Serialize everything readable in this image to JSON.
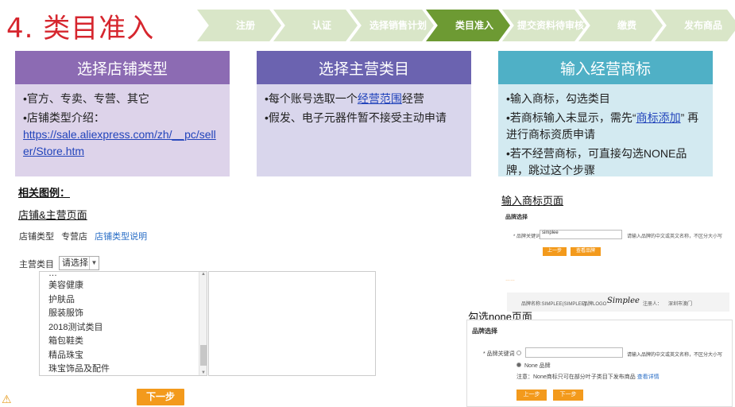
{
  "title": "4. 类目准入",
  "steps": [
    "注册",
    "认证",
    "选择销售计划",
    "类目准入",
    "提交资料待审核",
    "缴费",
    "发布商品"
  ],
  "active_step": "类目准入",
  "cards": [
    {
      "head": "选择店铺类型",
      "bullets": [
        "•官方、专卖、专营、其它",
        "•店铺类型介绍："
      ],
      "link": "https://sale.aliexpress.com/zh/__pc/seller/Store.htm"
    },
    {
      "head": "选择主营类目",
      "b1_pre": "•每个账号选取一个",
      "b1_link": "经营范围",
      "b1_post": "经营",
      "b2": "•假发、电子元器件暂不接受主动申请"
    },
    {
      "head": "输入经营商标",
      "b1": "•输入商标，勾选类目",
      "b2_pre": "•若商标输入未显示，需先“",
      "b2_link": "商标添加",
      "b2_post": "” 再进行商标资质申请",
      "b3": "•若不经营商标，可直接勾选NONE品牌，跳过这个步骤"
    }
  ],
  "related": "相关图例：",
  "shop_page": "店铺&主营页面",
  "shop_type_label": "店铺类型",
  "shop_type_value": "专营店",
  "shop_type_link": "店铺类型说明",
  "main_cat_label": "主营类目",
  "select_value": "请选择",
  "cat_items": [
    "美容健康",
    "护肤品",
    "服装服饰",
    "2018测试类目",
    "箱包鞋类",
    "精品珠宝",
    "珠宝饰品及配件"
  ],
  "next_button": "下一步",
  "brand_page": "输入商标页面",
  "none_page": "勾选none页面",
  "brand_select": "品牌选择",
  "brand_keyword_label": "* 品牌关键词",
  "brand_input_value": "simplee",
  "brand_hint": "请输入品牌的中文或英文名称，不区分大小写",
  "prev_button": "上一步",
  "view_brand_button": "查看品牌",
  "brand_name_label": "品牌名称:SIMPLEE(SIMPLEE)",
  "brand_logo_label": "品牌LOGO",
  "brand_logo_text": "Simplee",
  "registrant_label": "注册人：",
  "registrant_value": "深圳市澳门",
  "none_brand": "None 品牌",
  "none_note": "注意：None商标只可在部分叶子类目下发布商品",
  "none_note_link": "查看详情",
  "warn_icon": "⚠"
}
